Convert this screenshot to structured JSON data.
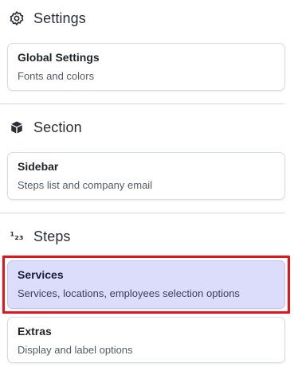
{
  "sections": {
    "settings": {
      "title": "Settings",
      "icon": "gear-icon",
      "cards": [
        {
          "title": "Global Settings",
          "subtitle": "Fonts and colors"
        }
      ]
    },
    "section": {
      "title": "Section",
      "icon": "cube-icon",
      "cards": [
        {
          "title": "Sidebar",
          "subtitle": "Steps list and company email"
        }
      ]
    },
    "steps": {
      "title": "Steps",
      "icon": "numbered-list-icon",
      "icon_glyph": "¹₂₃",
      "cards": [
        {
          "title": "Services",
          "subtitle": "Services, locations, employees selection options",
          "active": true
        },
        {
          "title": "Extras",
          "subtitle": "Display and label options"
        }
      ]
    }
  },
  "colors": {
    "active_bg": "#dcdcfb",
    "highlight": "#e3151c",
    "border": "#d9dde3"
  }
}
